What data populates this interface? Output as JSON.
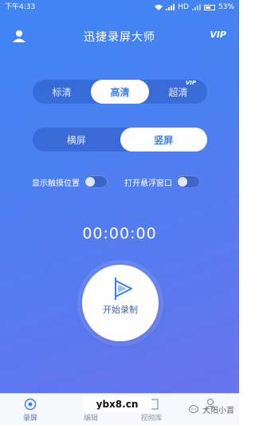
{
  "status_bar": {
    "time": "下午4:33",
    "network": "HD",
    "battery": "53%"
  },
  "header": {
    "title": "迅捷录屏大师",
    "vip_label": "VIP",
    "user_icon": "user-icon"
  },
  "quality": {
    "options": [
      "标清",
      "高清",
      "超清"
    ],
    "selected": "高清",
    "vip_badge": "VIP"
  },
  "orientation": {
    "options": [
      "横屏",
      "竖屏"
    ],
    "selected": "竖屏"
  },
  "toggles": {
    "show_touch": {
      "label": "显示触摸位置",
      "on": false
    },
    "float_window": {
      "label": "打开悬浮窗口",
      "on": false
    }
  },
  "timer": "00:00:00",
  "record_button": {
    "label": "开始录制",
    "icon": "play-icon"
  },
  "tabs": [
    {
      "label": "录屏",
      "icon": "record-icon",
      "active": true
    },
    {
      "label": "编辑",
      "icon": "edit-icon",
      "active": false
    },
    {
      "label": "视频库",
      "icon": "folder-icon",
      "active": false
    },
    {
      "label": "",
      "icon": "person-icon",
      "active": false
    }
  ],
  "watermarks": {
    "site": "ybx8.cn",
    "channel": "大阳小首"
  },
  "colors": {
    "accent": "#3b7ff0",
    "gradient_start": "#3f86f2",
    "gradient_end": "#6b72ee"
  }
}
